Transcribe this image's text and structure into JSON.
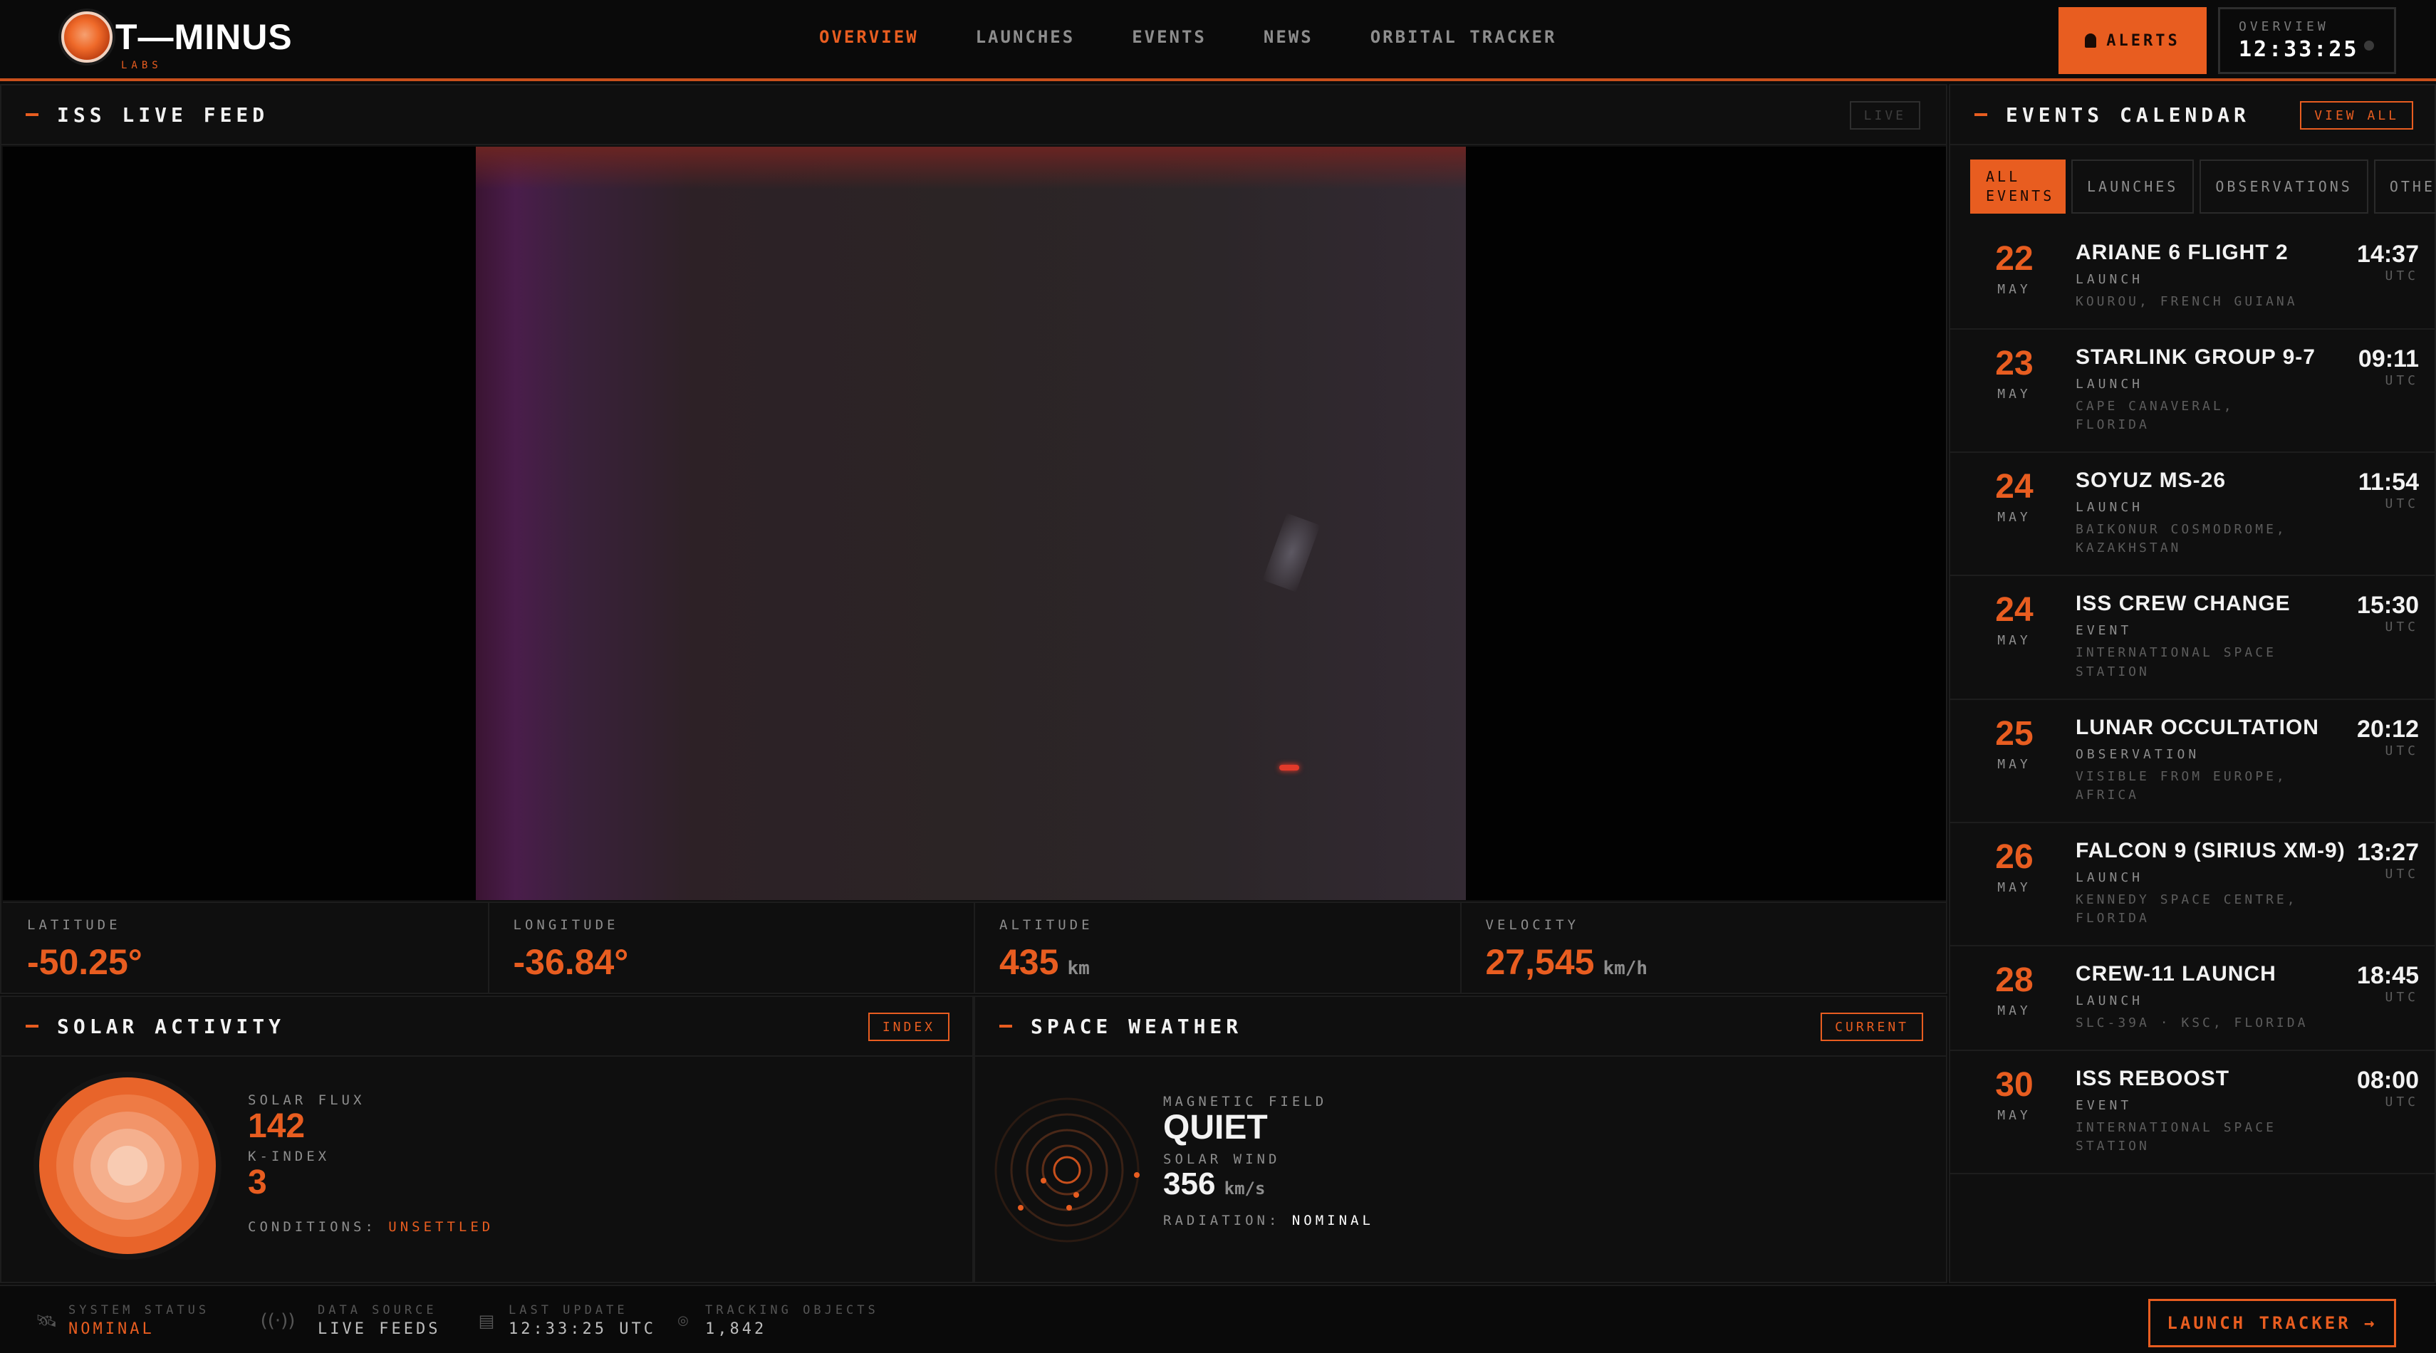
{
  "brand": {
    "name": "T—MINUS",
    "sub": "LABS"
  },
  "nav": [
    "OVERVIEW",
    "LAUNCHES",
    "EVENTS",
    "NEWS",
    "ORBITAL TRACKER"
  ],
  "header": {
    "alerts_label": "ALERTS",
    "clock_label": "OVERVIEW",
    "clock_time": "12:33:25"
  },
  "feed": {
    "title": "ISS LIVE FEED",
    "tag": "LIVE",
    "telemetry": [
      {
        "label": "LATITUDE",
        "value": "-50.25°",
        "unit": ""
      },
      {
        "label": "LONGITUDE",
        "value": "-36.84°",
        "unit": ""
      },
      {
        "label": "ALTITUDE",
        "value": "435",
        "unit": "km"
      },
      {
        "label": "VELOCITY",
        "value": "27,545",
        "unit": "km/h"
      }
    ]
  },
  "solar": {
    "title": "SOLAR ACTIVITY",
    "tag": "INDEX",
    "flux_label": "SOLAR FLUX",
    "flux_value": "142",
    "kindex_label": "K-INDEX",
    "kindex_value": "3",
    "conditions_label": "CONDITIONS:",
    "conditions_value": "UNSETTLED"
  },
  "weather": {
    "title": "SPACE WEATHER",
    "tag": "CURRENT",
    "field_label": "MAGNETIC FIELD",
    "field_value": "QUIET",
    "wind_label": "SOLAR WIND",
    "wind_value": "356",
    "wind_unit": "km/s",
    "radiation_label": "RADIATION:",
    "radiation_value": "NOMINAL"
  },
  "events": {
    "title": "EVENTS CALENDAR",
    "view_all": "VIEW ALL",
    "filters": [
      "ALL EVENTS",
      "LAUNCHES",
      "OBSERVATIONS",
      "OTHER"
    ],
    "items": [
      {
        "day": "22",
        "month": "MAY",
        "title": "ARIANE 6 FLIGHT 2",
        "kind": "LAUNCH",
        "location": "KOUROU, FRENCH GUIANA",
        "time": "14:37",
        "tz": "UTC"
      },
      {
        "day": "23",
        "month": "MAY",
        "title": "STARLINK GROUP 9-7",
        "kind": "LAUNCH",
        "location": "CAPE CANAVERAL, FLORIDA",
        "time": "09:11",
        "tz": "UTC"
      },
      {
        "day": "24",
        "month": "MAY",
        "title": "SOYUZ MS-26",
        "kind": "LAUNCH",
        "location": "BAIKONUR COSMODROME, KAZAKHSTAN",
        "time": "11:54",
        "tz": "UTC"
      },
      {
        "day": "24",
        "month": "MAY",
        "title": "ISS CREW CHANGE",
        "kind": "EVENT",
        "location": "INTERNATIONAL SPACE STATION",
        "time": "15:30",
        "tz": "UTC"
      },
      {
        "day": "25",
        "month": "MAY",
        "title": "LUNAR OCCULTATION",
        "kind": "OBSERVATION",
        "location": "VISIBLE FROM EUROPE, AFRICA",
        "time": "20:12",
        "tz": "UTC"
      },
      {
        "day": "26",
        "month": "MAY",
        "title": "FALCON 9 (SIRIUS XM-9)",
        "kind": "LAUNCH",
        "location": "KENNEDY SPACE CENTRE, FLORIDA",
        "time": "13:27",
        "tz": "UTC"
      },
      {
        "day": "28",
        "month": "MAY",
        "title": "CREW-11 LAUNCH",
        "kind": "LAUNCH",
        "location": "SLC-39A · KSC, FLORIDA",
        "time": "18:45",
        "tz": "UTC"
      },
      {
        "day": "30",
        "month": "MAY",
        "title": "ISS REBOOST",
        "kind": "EVENT",
        "location": "INTERNATIONAL SPACE STATION",
        "time": "08:00",
        "tz": "UTC"
      }
    ]
  },
  "footer": {
    "system_label": "SYSTEM STATUS",
    "system_value": "NOMINAL",
    "source_label": "DATA SOURCE",
    "source_value": "LIVE FEEDS",
    "update_label": "LAST UPDATE",
    "update_value": "12:33:25 UTC",
    "tracking_label": "TRACKING OBJECTS",
    "tracking_value": "1,842",
    "launch_button": "LAUNCH TRACKER →"
  },
  "colors": {
    "accent": "#e85d20",
    "background": "#0b0b0b"
  }
}
